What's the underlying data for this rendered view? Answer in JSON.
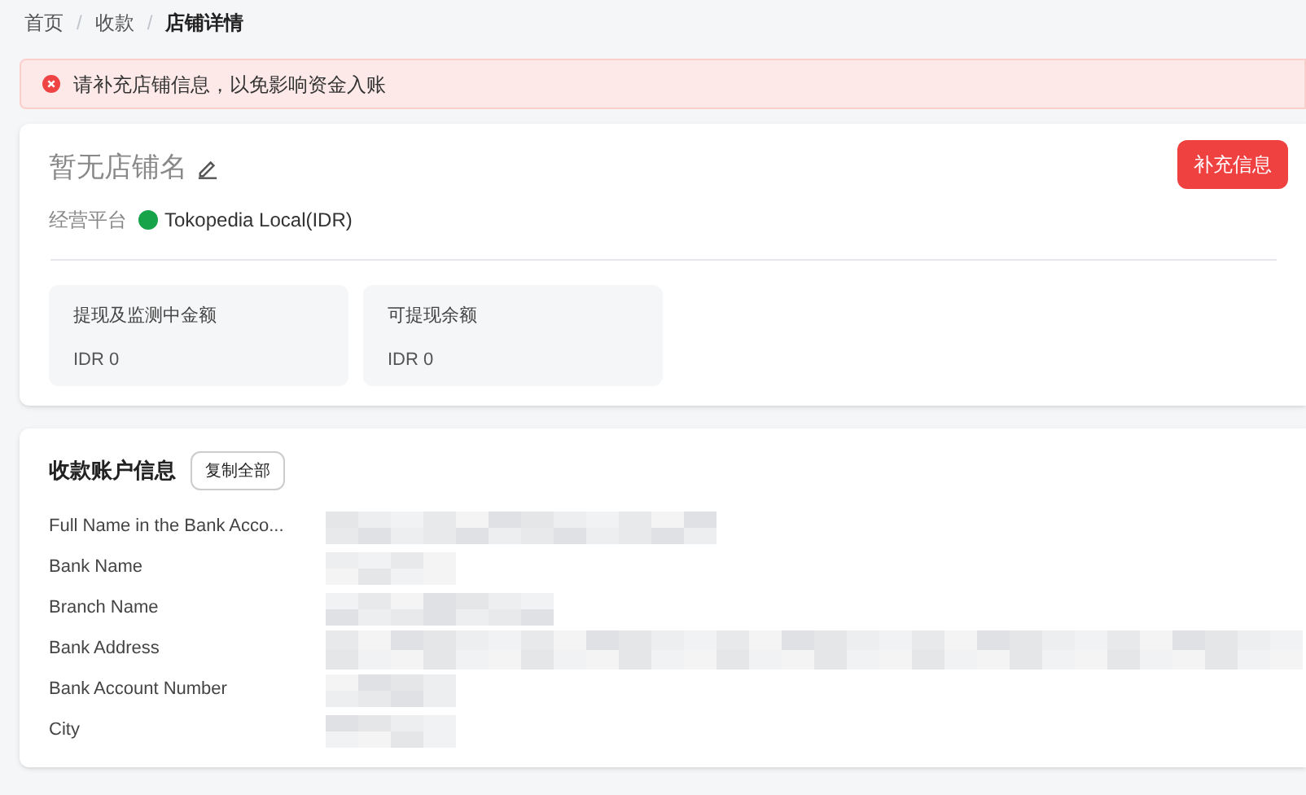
{
  "breadcrumb": [
    {
      "label": "首页",
      "current": false
    },
    {
      "label": "收款",
      "current": false
    },
    {
      "label": "店铺详情",
      "current": true
    }
  ],
  "breadcrumb_separator": "/",
  "alert": {
    "message": "请补充店铺信息，以免影响资金入账"
  },
  "shop": {
    "name": "暂无店铺名",
    "action": "补充信息",
    "platform_label": "经营平台",
    "platform": "Tokopedia Local(IDR)"
  },
  "balances": [
    {
      "label": "提现及监测中金额",
      "value": "IDR 0"
    },
    {
      "label": "可提现余额",
      "value": "IDR 0"
    }
  ],
  "account": {
    "title": "收款账户信息",
    "copy_button": "复制全部",
    "fields": [
      {
        "label": "Full Name in the Bank Acco..."
      },
      {
        "label": "Bank Name"
      },
      {
        "label": "Branch Name"
      },
      {
        "label": "Bank Address"
      },
      {
        "label": "Bank Account Number"
      },
      {
        "label": "City"
      }
    ]
  }
}
